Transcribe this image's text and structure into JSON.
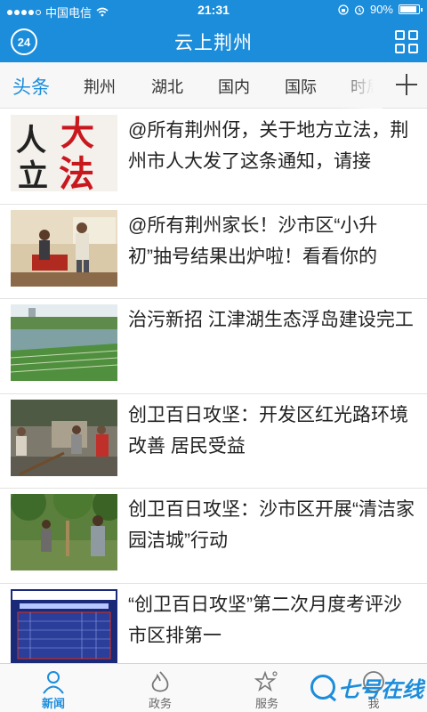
{
  "status_bar": {
    "carrier": "中国电信",
    "time": "21:31",
    "battery": "90%",
    "battery_level": 0.9
  },
  "header": {
    "logo_text": "24",
    "title": "云上荆州",
    "menu_icon": "grid-icon"
  },
  "tabs": [
    "头条",
    "荆州",
    "湖北",
    "国内",
    "国际",
    "时局"
  ],
  "active_tab": "头条",
  "news": [
    {
      "title": "@所有荆州伢，关于地方立法，荆州市人大发了这条通知，请接",
      "image": "人大立法"
    },
    {
      "title": "@所有荆州家长！沙市区“小升初”抽号结果出炉啦！看看你的"
    },
    {
      "title": "治污新招 江津湖生态浮岛建设完工"
    },
    {
      "title": "创卫百日攻坚：开发区红光路环境改善 居民受益"
    },
    {
      "title": "创卫百日攻坚：沙市区开展“清洁家园洁城”行动"
    },
    {
      "title": "“创卫百日攻坚”第二次月度考评沙市区排第一"
    }
  ],
  "bottom_nav": [
    {
      "label": "新闻",
      "icon": "person-icon",
      "active": true
    },
    {
      "label": "政务",
      "icon": "flame-icon",
      "active": false
    },
    {
      "label": "服务",
      "icon": "star-icon",
      "active": false
    },
    {
      "label": "我",
      "icon": "user-icon",
      "active": false
    }
  ],
  "watermark": "七号在线",
  "colors": {
    "brand": "#1c8ddb",
    "text": "#222222",
    "divider": "#e2e2e2"
  }
}
